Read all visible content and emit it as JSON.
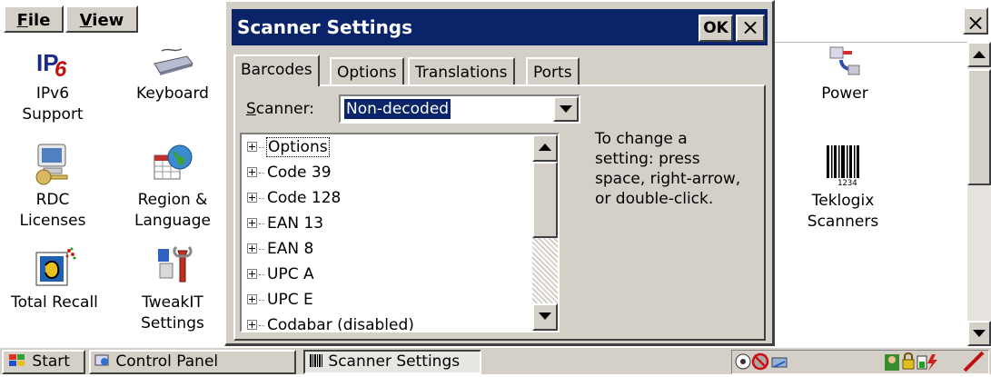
{
  "control_panel": {
    "menu": [
      {
        "label": "File",
        "accel": "F"
      },
      {
        "label": "View",
        "accel": "V"
      }
    ],
    "items_left": [
      {
        "label_line1": "IPv6",
        "label_line2": "Support",
        "icon": "ipv6-icon"
      },
      {
        "label_line1": "Keyboard",
        "label_line2": "",
        "icon": "keyboard-icon"
      },
      {
        "label_line1": "RDC",
        "label_line2": "Licenses",
        "icon": "rdc-licenses-icon"
      },
      {
        "label_line1": "Region &",
        "label_line2": "Language",
        "icon": "globe-calendar-icon"
      },
      {
        "label_line1": "Total Recall",
        "label_line2": "",
        "icon": "total-recall-icon"
      },
      {
        "label_line1": "TweakIT",
        "label_line2": "Settings",
        "icon": "tweakit-icon"
      }
    ],
    "items_right": [
      {
        "label_line1": "Power",
        "label_line2": "",
        "icon": "power-plug-icon"
      },
      {
        "label_line1": "Teklogix",
        "label_line2": "Scanners",
        "icon": "barcode-icon",
        "barcode_digits": "1234"
      }
    ],
    "close_glyph": "×"
  },
  "dialog": {
    "title": "Scanner Settings",
    "ok_label": "OK",
    "close_glyph": "×",
    "tabs": [
      "Barcodes",
      "Options",
      "Translations",
      "Ports"
    ],
    "active_tab": "Barcodes",
    "scanner_label": "Scanner:",
    "scanner_accel": "S",
    "scanner_value": "Non-decoded",
    "tree_items": [
      "Options",
      "Code 39",
      "Code 128",
      "EAN 13",
      "EAN 8",
      "UPC A",
      "UPC E",
      "Codabar (disabled)"
    ],
    "help_text": [
      "To change a",
      "setting: press",
      "space, right-arrow,",
      "or double-click."
    ]
  },
  "taskbar": {
    "start_label": "Start",
    "buttons": [
      "Control Panel",
      "Scanner Settings"
    ],
    "active_button": "Scanner Settings"
  },
  "colors": {
    "title_bar": "#0a246a",
    "face": "#d4d0c8",
    "selection": "#0a246a"
  }
}
